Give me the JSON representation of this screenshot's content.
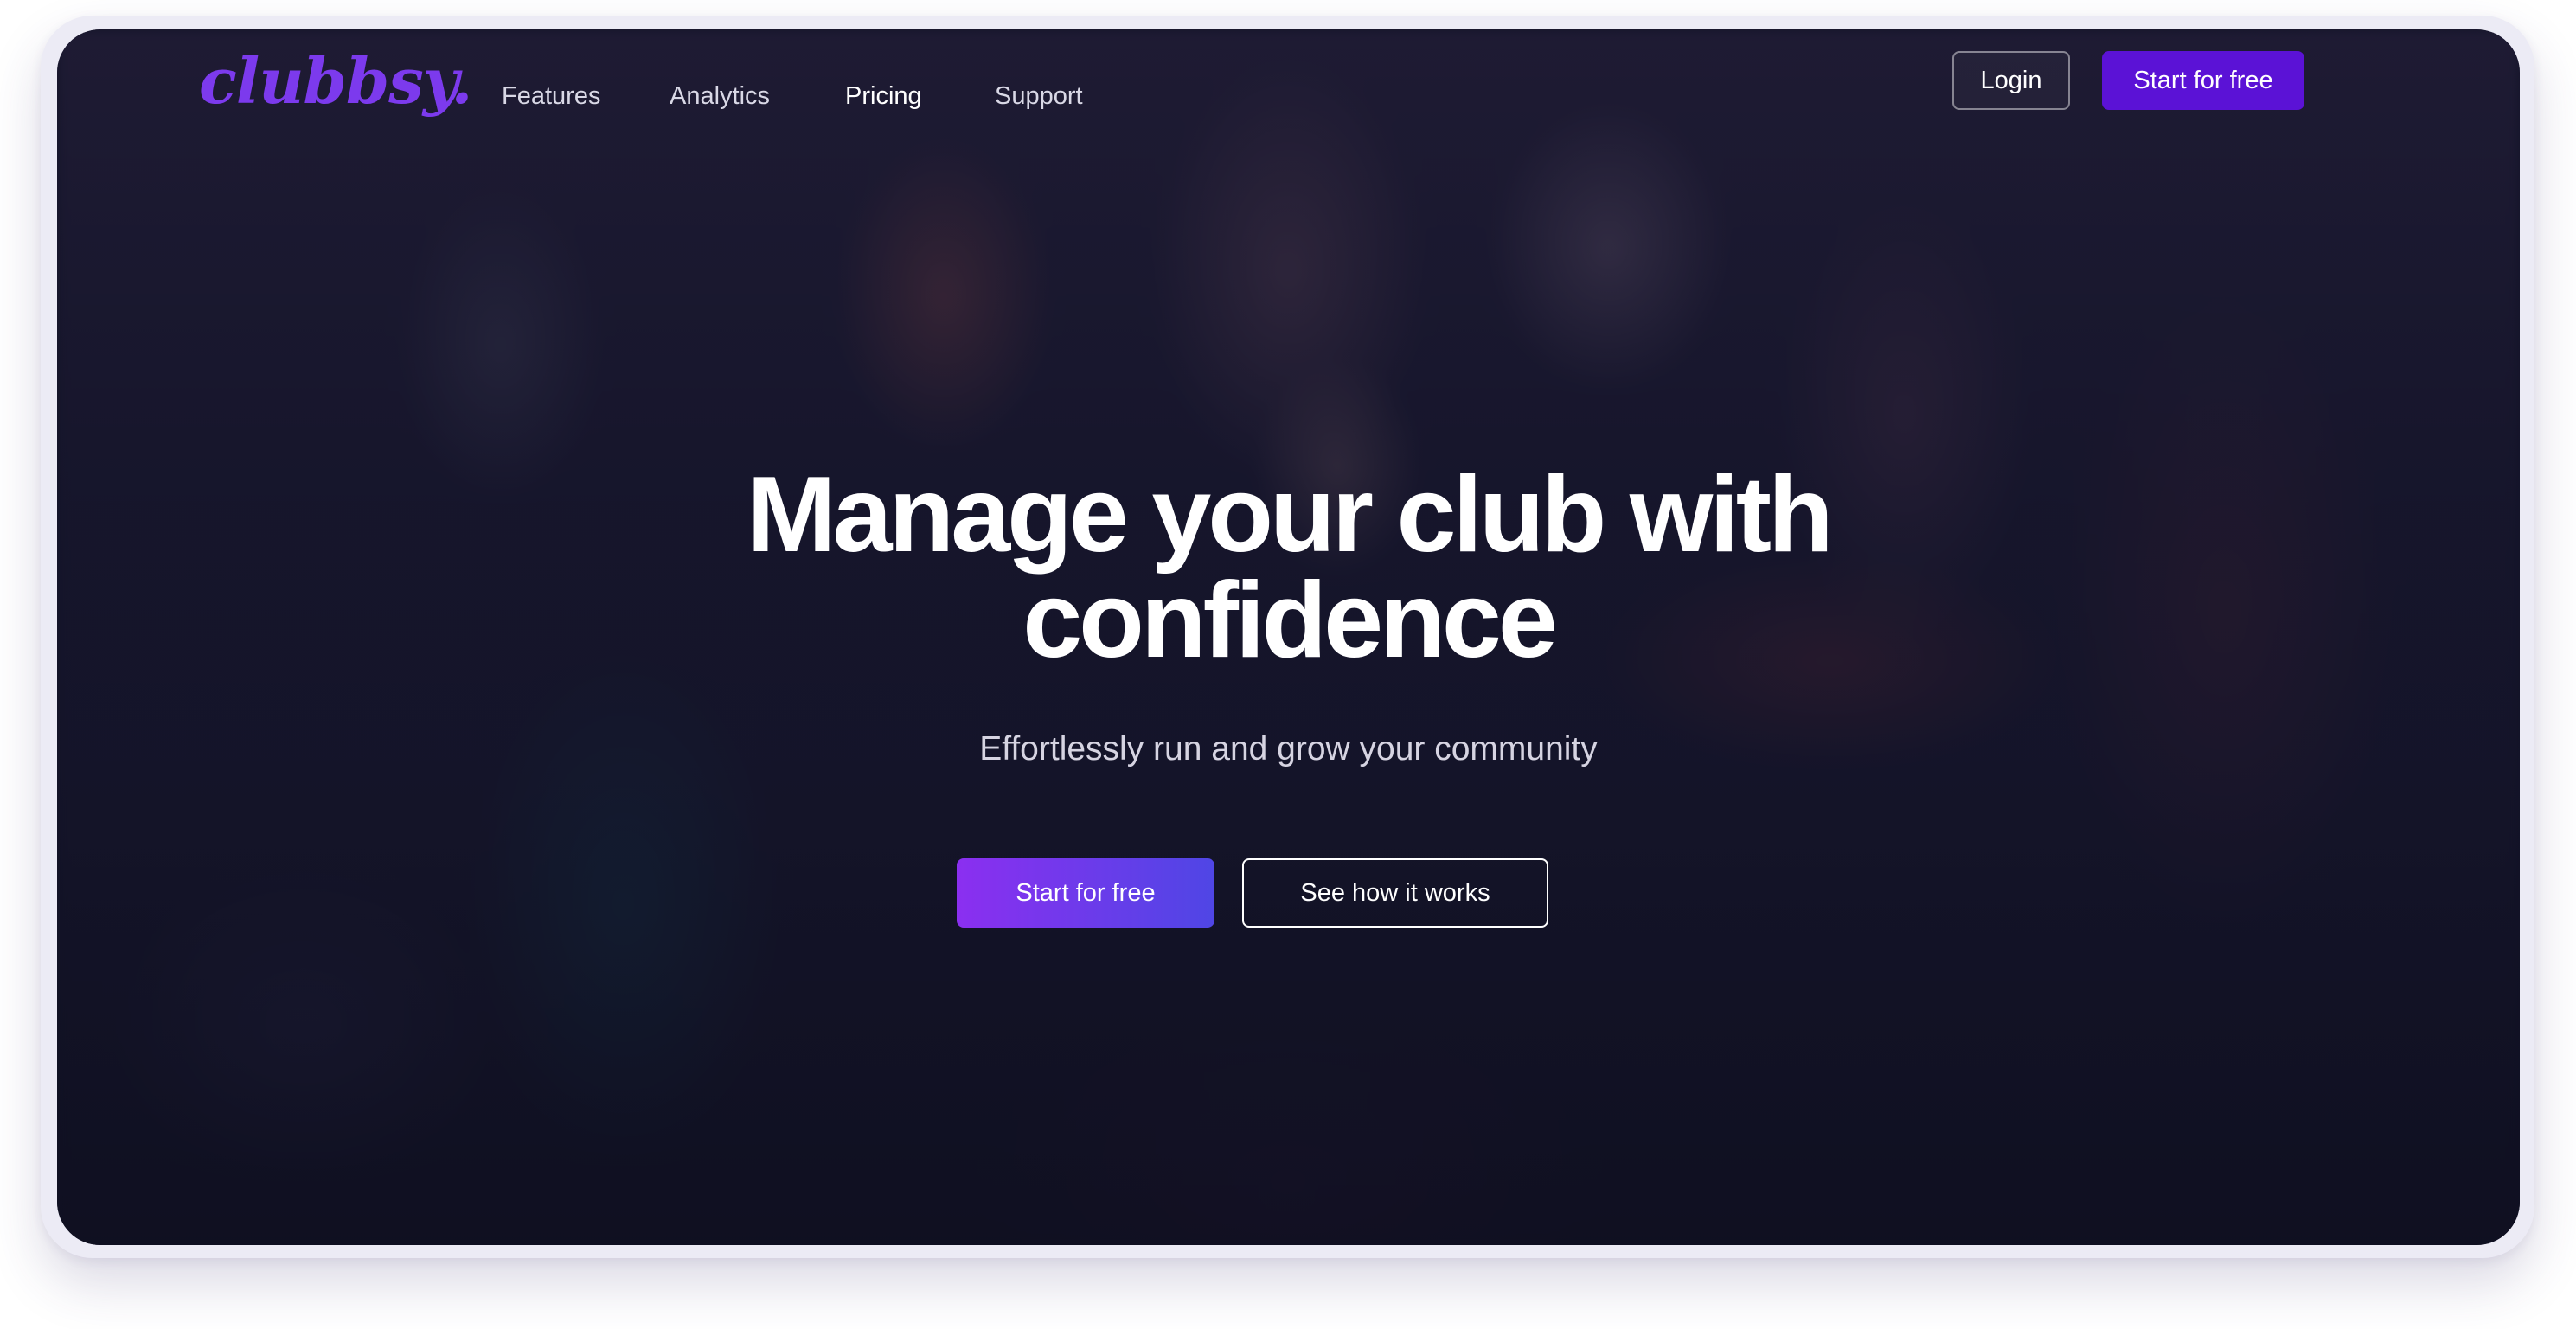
{
  "brand": {
    "logo_text": "clubbsy.",
    "accent_color": "#7c3aed",
    "primary_button_color": "#5b12d6"
  },
  "nav": {
    "links": [
      {
        "label": "Features"
      },
      {
        "label": "Analytics"
      },
      {
        "label": "Pricing"
      },
      {
        "label": "Support"
      }
    ],
    "login_label": "Login",
    "start_label": "Start for free"
  },
  "hero": {
    "headline_line1": "Manage your club with",
    "headline_line2": "confidence",
    "subheadline": "Effortlessly run and grow your community",
    "primary_cta": "Start for free",
    "secondary_cta": "See how it works",
    "background": "blurred nightclub crowd photo"
  }
}
